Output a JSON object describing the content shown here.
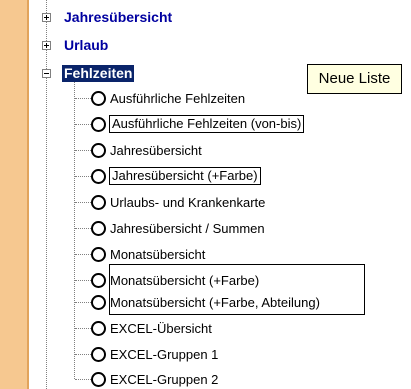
{
  "tree": {
    "groups": [
      {
        "label": "Jahresübersicht",
        "expander": "plus"
      },
      {
        "label": "Urlaub",
        "expander": "plus"
      },
      {
        "label": "Fehlzeiten",
        "expander": "minus",
        "selected": true
      }
    ],
    "items": [
      {
        "label": "Ausführliche Fehlzeiten"
      },
      {
        "label": "Ausführliche Fehlzeiten (von-bis)"
      },
      {
        "label": "Jahresübersicht"
      },
      {
        "label": "Jahresübersicht (+Farbe)"
      },
      {
        "label": "Urlaubs- und Krankenkarte"
      },
      {
        "label": "Jahresübersicht / Summen"
      },
      {
        "label": "Monatsübersicht"
      },
      {
        "label": "Monatsübersicht (+Farbe)"
      },
      {
        "label": "Monatsübersicht (+Farbe, Abteilung)"
      },
      {
        "label": "EXCEL-Übersicht"
      },
      {
        "label": "EXCEL-Gruppen 1"
      },
      {
        "label": "EXCEL-Gruppen 2"
      }
    ]
  },
  "tooltip": {
    "text": "Neue Liste"
  },
  "colors": {
    "sidebar": "#f6c890",
    "group_text": "#0000a0",
    "selection_bg": "#0a246a",
    "tooltip_bg": "#ffffe1"
  }
}
